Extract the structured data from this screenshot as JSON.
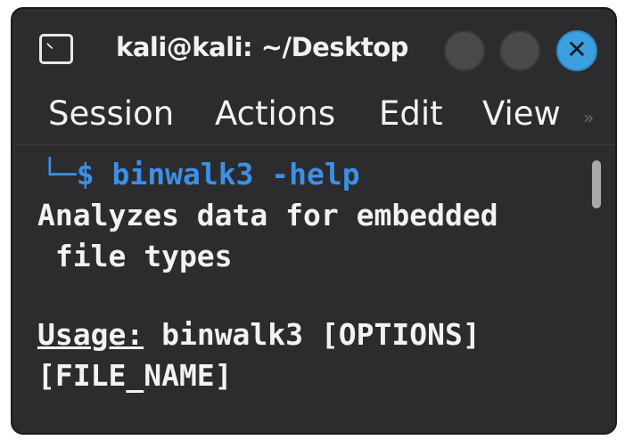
{
  "window": {
    "title": "kali@kali: ~/Desktop",
    "close_glyph": "✕",
    "icons": [
      "terminal-icon",
      "minimize-button",
      "maximize-button",
      "close-icon"
    ],
    "accent_color": "#3d9fe0"
  },
  "menubar": {
    "items": [
      "Session",
      "Actions",
      "Edit",
      "View"
    ],
    "overflow_glyph": "»"
  },
  "terminal": {
    "prompt": "└─$",
    "command": "binwalk3 -help",
    "output": {
      "description_line1": "Analyzes data for embedded",
      "description_line2": " file types",
      "usage_label": "Usage:",
      "usage_rest": " binwalk3 [OPTIONS]",
      "usage_line2": "[FILE_NAME]"
    },
    "prompt_color": "#3d8fe8",
    "text_color": "#f2f2f2"
  }
}
